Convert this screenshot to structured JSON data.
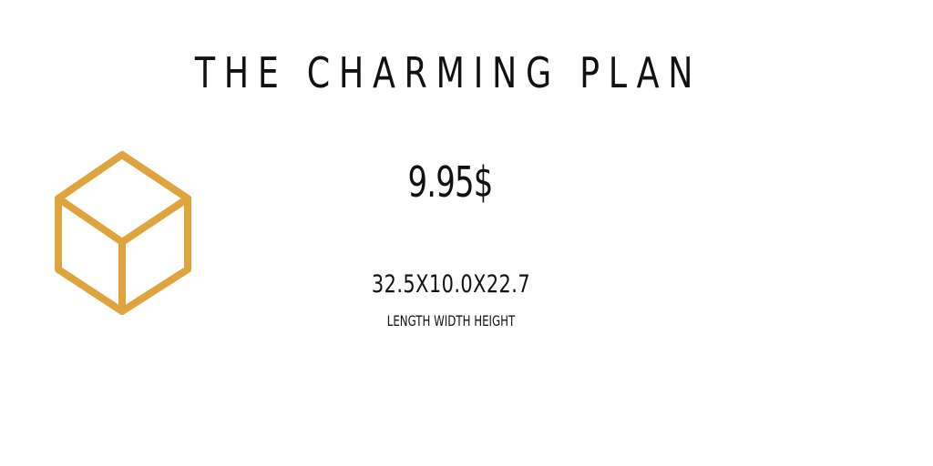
{
  "plan": {
    "title": "THE CHARMING PLAN",
    "price": "9.95$",
    "dimensions": "32.5X10.0X22.7",
    "dimension_labels": "LENGTH WIDTH HEIGHT"
  },
  "icon": {
    "name": "cube-icon",
    "color": "#E0A43E"
  }
}
